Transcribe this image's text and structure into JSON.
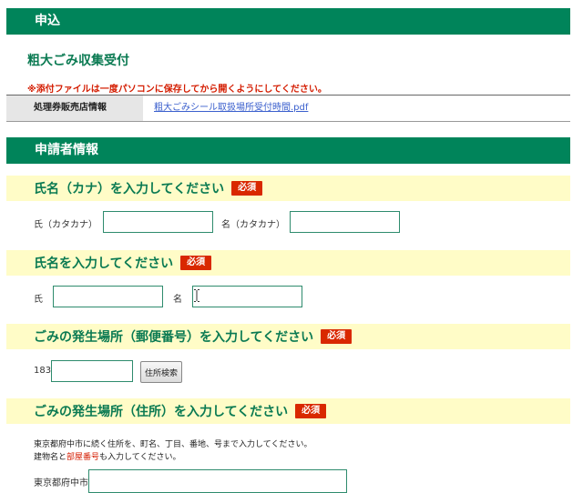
{
  "sections": {
    "apply": "申込",
    "applicant": "申請者情報"
  },
  "page": {
    "subtitle": "粗大ごみ収集受付",
    "warning": "※添付ファイルは一度パソコンに保存してから開くようにしてください。"
  },
  "info": {
    "label": "処理券販売店情報",
    "link": "粗大ごみシール取扱場所受付時間.pdf"
  },
  "required": "必須",
  "q_kana": {
    "title": "氏名（カナ）を入力してください",
    "last_label": "氏（カタカナ）",
    "first_label": "名（カタカナ）",
    "last_value": "",
    "first_value": ""
  },
  "q_name": {
    "title": "氏名を入力してください",
    "last_label": "氏",
    "first_label": "名",
    "last_value": "",
    "first_value": ""
  },
  "q_zip": {
    "title": "ごみの発生場所（郵便番号）を入力してください",
    "prefix": "183",
    "value": "",
    "button": "住所検索"
  },
  "q_addr": {
    "title": "ごみの発生場所（住所）を入力してください",
    "note1": "東京都府中市に続く住所を、町名、丁目、番地、号まで入力してください。",
    "note2_a": "建物名と",
    "note2_red": "部屋番号",
    "note2_b": "も入力してください。",
    "prefix": "東京都府中市",
    "value": ""
  }
}
